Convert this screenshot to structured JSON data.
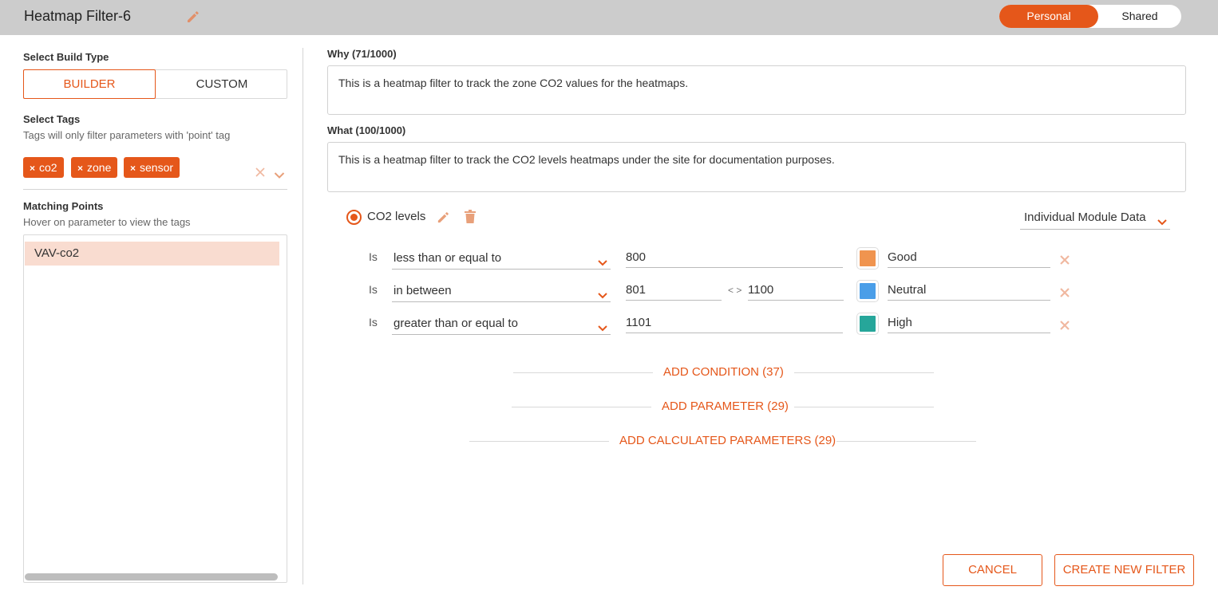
{
  "header": {
    "title": "Heatmap Filter-6",
    "edit_icon": "pencil-icon",
    "toggle": {
      "personal": "Personal",
      "shared": "Shared",
      "selected": "Personal"
    }
  },
  "left": {
    "build_type_label": "Select Build Type",
    "builder_label": "BUILDER",
    "custom_label": "CUSTOM",
    "selected_build": "BUILDER",
    "tags_label": "Select Tags",
    "tags_hint": "Tags will only filter parameters with 'point' tag",
    "tags": [
      {
        "label": "co2"
      },
      {
        "label": "zone"
      },
      {
        "label": "sensor"
      }
    ],
    "tag_remove_glyph": "×",
    "matching_label": "Matching Points",
    "matching_hint": "Hover on parameter to view the tags",
    "points": [
      "VAV-co2"
    ]
  },
  "why": {
    "label": "Why (71/1000)",
    "value": "This is a heatmap filter to track the zone CO2 values for the heatmaps."
  },
  "what": {
    "label": "What (100/1000)",
    "value": "This is a heatmap filter to track the CO2 levels heatmaps under the site for documentation purposes."
  },
  "parameter": {
    "name": "CO2 levels",
    "data_source": "Individual Module Data",
    "conditions": [
      {
        "is": "Is",
        "operator": "less than or equal to",
        "value": "800",
        "value2": "",
        "color": "#f0944f",
        "label": "Good"
      },
      {
        "is": "Is",
        "operator": "in between",
        "value": "801",
        "between": "< >",
        "value2": "1100",
        "color": "#4a9ee8",
        "label": "Neutral"
      },
      {
        "is": "Is",
        "operator": "greater than or equal to",
        "value": "1101",
        "value2": "",
        "color": "#26a69a",
        "label": "High"
      }
    ]
  },
  "actions": {
    "add_condition": "ADD CONDITION (37)",
    "add_parameter": "ADD PARAMETER (29)",
    "add_calculated": "ADD CALCULATED PARAMETERS (29)",
    "cancel": "CANCEL",
    "create": "CREATE NEW FILTER"
  },
  "colors": {
    "accent": "#e5571a",
    "header_bg": "#cccccc",
    "selected_point_bg": "#f9dcd0"
  }
}
